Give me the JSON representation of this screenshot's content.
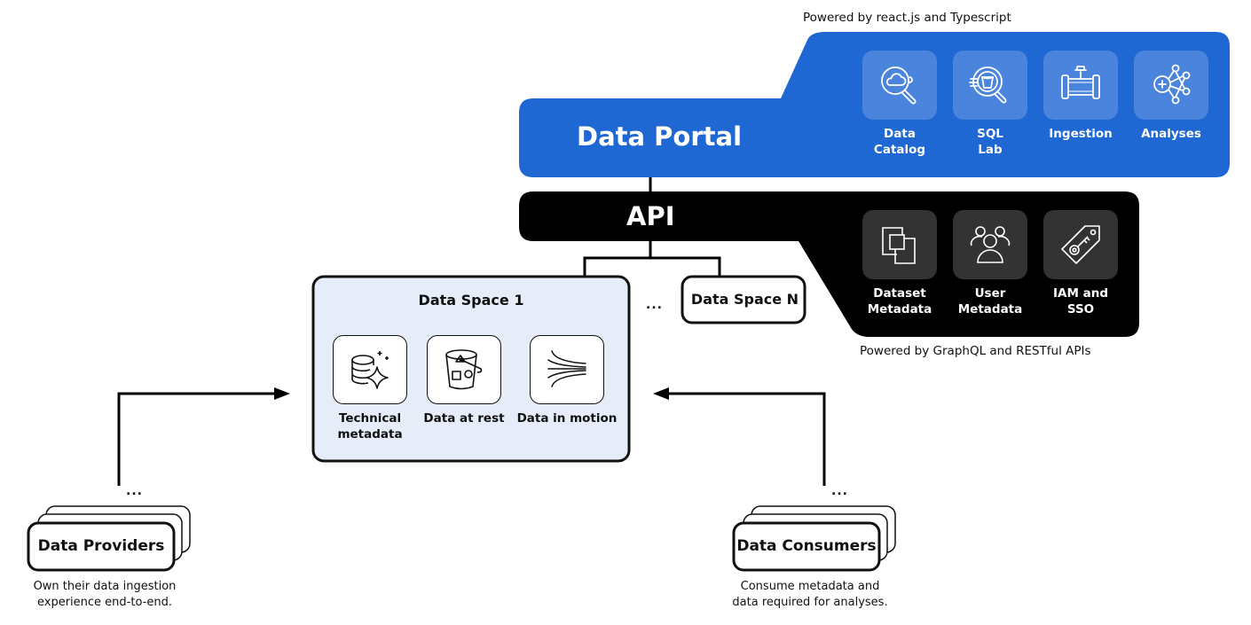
{
  "data_portal": {
    "title": "Data Portal",
    "powered_by": "Powered by react.js and Typescript",
    "color": "#1f67d2",
    "tile_color": "#4a84dc",
    "modules": [
      {
        "label_line1": "Data",
        "label_line2": "Catalog",
        "icon": "cloud-search-icon"
      },
      {
        "label_line1": "SQL",
        "label_line2": "Lab",
        "icon": "bucket-search-icon"
      },
      {
        "label_line1": "Ingestion",
        "label_line2": "",
        "icon": "pipe-valve-icon"
      },
      {
        "label_line1": "Analyses",
        "label_line2": "",
        "icon": "network-nodes-icon"
      }
    ]
  },
  "api": {
    "title": "API",
    "powered_by": "Powered by GraphQL and RESTful APIs",
    "color": "#000000",
    "tile_color": "#333333",
    "modules": [
      {
        "label_line1": "Dataset",
        "label_line2": "Metadata",
        "icon": "overlapping-squares-icon"
      },
      {
        "label_line1": "User",
        "label_line2": "Metadata",
        "icon": "users-group-icon"
      },
      {
        "label_line1": "IAM and",
        "label_line2": "SSO",
        "icon": "key-tag-icon"
      }
    ]
  },
  "data_space_1": {
    "title": "Data Space 1",
    "background": "#e6ecf8",
    "items": [
      {
        "label_line1": "Technical",
        "label_line2": "metadata",
        "icon": "database-sparkle-icon"
      },
      {
        "label_line1": "Data at rest",
        "label_line2": "",
        "icon": "bucket-shapes-icon"
      },
      {
        "label_line1": "Data in motion",
        "label_line2": "",
        "icon": "flow-lines-icon"
      }
    ]
  },
  "data_space_n": {
    "title": "Data Space N"
  },
  "spaces_ellipsis": "...",
  "providers": {
    "title": "Data Providers",
    "ellipsis": "...",
    "description_line1": "Own their data ingestion",
    "description_line2": "experience end-to-end."
  },
  "consumers": {
    "title": "Data Consumers",
    "ellipsis": "...",
    "description_line1": "Consume metadata and",
    "description_line2": "data required for analyses."
  }
}
